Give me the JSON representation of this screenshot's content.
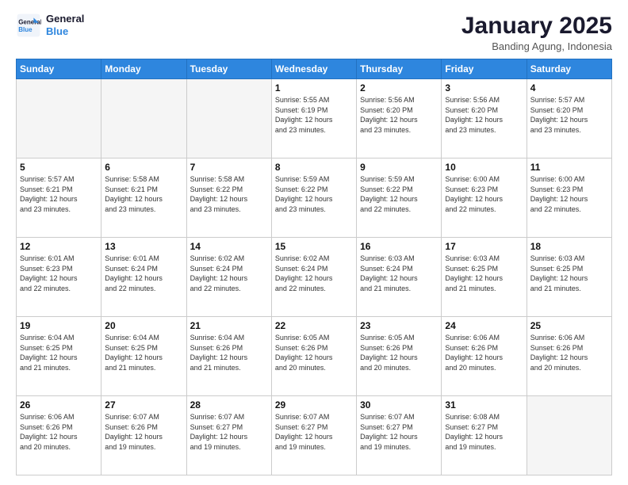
{
  "header": {
    "logo_line1": "General",
    "logo_line2": "Blue",
    "month": "January 2025",
    "location": "Banding Agung, Indonesia"
  },
  "weekdays": [
    "Sunday",
    "Monday",
    "Tuesday",
    "Wednesday",
    "Thursday",
    "Friday",
    "Saturday"
  ],
  "weeks": [
    [
      {
        "day": "",
        "info": ""
      },
      {
        "day": "",
        "info": ""
      },
      {
        "day": "",
        "info": ""
      },
      {
        "day": "1",
        "info": "Sunrise: 5:55 AM\nSunset: 6:19 PM\nDaylight: 12 hours\nand 23 minutes."
      },
      {
        "day": "2",
        "info": "Sunrise: 5:56 AM\nSunset: 6:20 PM\nDaylight: 12 hours\nand 23 minutes."
      },
      {
        "day": "3",
        "info": "Sunrise: 5:56 AM\nSunset: 6:20 PM\nDaylight: 12 hours\nand 23 minutes."
      },
      {
        "day": "4",
        "info": "Sunrise: 5:57 AM\nSunset: 6:20 PM\nDaylight: 12 hours\nand 23 minutes."
      }
    ],
    [
      {
        "day": "5",
        "info": "Sunrise: 5:57 AM\nSunset: 6:21 PM\nDaylight: 12 hours\nand 23 minutes."
      },
      {
        "day": "6",
        "info": "Sunrise: 5:58 AM\nSunset: 6:21 PM\nDaylight: 12 hours\nand 23 minutes."
      },
      {
        "day": "7",
        "info": "Sunrise: 5:58 AM\nSunset: 6:22 PM\nDaylight: 12 hours\nand 23 minutes."
      },
      {
        "day": "8",
        "info": "Sunrise: 5:59 AM\nSunset: 6:22 PM\nDaylight: 12 hours\nand 23 minutes."
      },
      {
        "day": "9",
        "info": "Sunrise: 5:59 AM\nSunset: 6:22 PM\nDaylight: 12 hours\nand 22 minutes."
      },
      {
        "day": "10",
        "info": "Sunrise: 6:00 AM\nSunset: 6:23 PM\nDaylight: 12 hours\nand 22 minutes."
      },
      {
        "day": "11",
        "info": "Sunrise: 6:00 AM\nSunset: 6:23 PM\nDaylight: 12 hours\nand 22 minutes."
      }
    ],
    [
      {
        "day": "12",
        "info": "Sunrise: 6:01 AM\nSunset: 6:23 PM\nDaylight: 12 hours\nand 22 minutes."
      },
      {
        "day": "13",
        "info": "Sunrise: 6:01 AM\nSunset: 6:24 PM\nDaylight: 12 hours\nand 22 minutes."
      },
      {
        "day": "14",
        "info": "Sunrise: 6:02 AM\nSunset: 6:24 PM\nDaylight: 12 hours\nand 22 minutes."
      },
      {
        "day": "15",
        "info": "Sunrise: 6:02 AM\nSunset: 6:24 PM\nDaylight: 12 hours\nand 22 minutes."
      },
      {
        "day": "16",
        "info": "Sunrise: 6:03 AM\nSunset: 6:24 PM\nDaylight: 12 hours\nand 21 minutes."
      },
      {
        "day": "17",
        "info": "Sunrise: 6:03 AM\nSunset: 6:25 PM\nDaylight: 12 hours\nand 21 minutes."
      },
      {
        "day": "18",
        "info": "Sunrise: 6:03 AM\nSunset: 6:25 PM\nDaylight: 12 hours\nand 21 minutes."
      }
    ],
    [
      {
        "day": "19",
        "info": "Sunrise: 6:04 AM\nSunset: 6:25 PM\nDaylight: 12 hours\nand 21 minutes."
      },
      {
        "day": "20",
        "info": "Sunrise: 6:04 AM\nSunset: 6:25 PM\nDaylight: 12 hours\nand 21 minutes."
      },
      {
        "day": "21",
        "info": "Sunrise: 6:04 AM\nSunset: 6:26 PM\nDaylight: 12 hours\nand 21 minutes."
      },
      {
        "day": "22",
        "info": "Sunrise: 6:05 AM\nSunset: 6:26 PM\nDaylight: 12 hours\nand 20 minutes."
      },
      {
        "day": "23",
        "info": "Sunrise: 6:05 AM\nSunset: 6:26 PM\nDaylight: 12 hours\nand 20 minutes."
      },
      {
        "day": "24",
        "info": "Sunrise: 6:06 AM\nSunset: 6:26 PM\nDaylight: 12 hours\nand 20 minutes."
      },
      {
        "day": "25",
        "info": "Sunrise: 6:06 AM\nSunset: 6:26 PM\nDaylight: 12 hours\nand 20 minutes."
      }
    ],
    [
      {
        "day": "26",
        "info": "Sunrise: 6:06 AM\nSunset: 6:26 PM\nDaylight: 12 hours\nand 20 minutes."
      },
      {
        "day": "27",
        "info": "Sunrise: 6:07 AM\nSunset: 6:26 PM\nDaylight: 12 hours\nand 19 minutes."
      },
      {
        "day": "28",
        "info": "Sunrise: 6:07 AM\nSunset: 6:27 PM\nDaylight: 12 hours\nand 19 minutes."
      },
      {
        "day": "29",
        "info": "Sunrise: 6:07 AM\nSunset: 6:27 PM\nDaylight: 12 hours\nand 19 minutes."
      },
      {
        "day": "30",
        "info": "Sunrise: 6:07 AM\nSunset: 6:27 PM\nDaylight: 12 hours\nand 19 minutes."
      },
      {
        "day": "31",
        "info": "Sunrise: 6:08 AM\nSunset: 6:27 PM\nDaylight: 12 hours\nand 19 minutes."
      },
      {
        "day": "",
        "info": ""
      }
    ]
  ]
}
